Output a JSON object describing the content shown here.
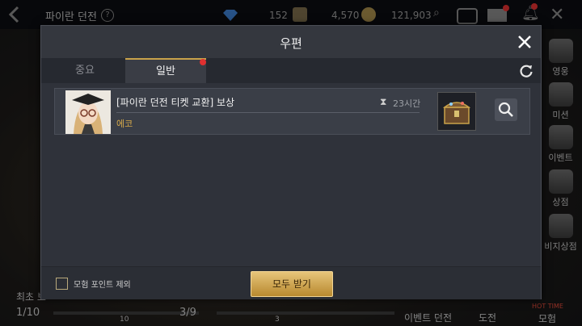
{
  "hud": {
    "title": "파이란 던전",
    "back_icon": "back-chevron-icon",
    "currency": [
      {
        "icon": "diamond-icon",
        "value": "152"
      },
      {
        "icon": "ticket-icon",
        "value": "4,570"
      },
      {
        "icon": "gold-coin-icon",
        "value": "121,903"
      }
    ],
    "side_menu": [
      "영웅",
      "미션",
      "이벤트",
      "상점",
      "비지상점"
    ],
    "bottom": {
      "first_label": "최초 보",
      "progress_left": "1/10",
      "progress_mid": "3/9",
      "tick_a": "10",
      "tick_b": "3",
      "event_dungeon": "이벤트 던전",
      "challenge": "도전",
      "adventure": "모험",
      "hottime": "HOT TIME"
    }
  },
  "modal": {
    "title": "우편",
    "tabs": [
      {
        "label": "중요",
        "active": false
      },
      {
        "label": "일반",
        "active": true,
        "notification": true
      }
    ],
    "mails": [
      {
        "title": "[파이란 던전 티켓 교환] 보상",
        "sender": "에코",
        "time_left": "23시간",
        "reward_icon": "treasure-chest-icon"
      }
    ],
    "footer": {
      "exclude_label": "모험 포인트 제외",
      "exclude_checked": false,
      "receive_all_label": "모두 받기"
    }
  },
  "colors": {
    "accent_gold": "#d6a94a",
    "notification_red": "#e03030",
    "button_gold": "#c9a24a"
  }
}
